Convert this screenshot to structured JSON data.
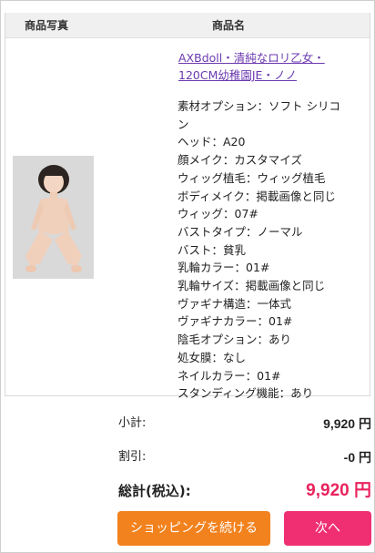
{
  "table_header": {
    "photo_label": "商品写真",
    "name_label": "商品名"
  },
  "product": {
    "name": "AXBdoll・清純なロリ乙女・120CM幼稚園JE・ノノ",
    "image_icon": "product-photo",
    "options": [
      "素材オプション：ソフト シリコン",
      "ヘッド：A20",
      "顔メイク：カスタマイズ",
      "ウィッグ植毛：ウィッグ植毛",
      "ボディメイク：掲載画像と同じ",
      "ウィッグ：07#",
      "バストタイプ：ノーマル",
      "バスト：貧乳",
      "乳輪カラー：01#",
      "乳輪サイズ：掲載画像と同じ",
      "ヴァギナ構造：一体式",
      "ヴァギナカラー：01#",
      "陰毛オプション：あり",
      "処女膜：なし",
      "ネイルカラー：01#",
      "スタンディング機能：あり"
    ]
  },
  "summary": {
    "subtotal_label": "小計:",
    "subtotal_value": "9,920 円",
    "discount_label": "割引:",
    "discount_value": "-0 円",
    "total_label": "総計(税込):",
    "total_value": "9,920 円"
  },
  "buttons": {
    "continue_label": "ショッピングを続ける",
    "next_label": "次へ"
  },
  "colors": {
    "link": "#6b3ab0",
    "total": "#e8235d",
    "continue_button": "#f2821e",
    "next_button": "#ef2f72",
    "header_bg": "#f0f0f0"
  }
}
